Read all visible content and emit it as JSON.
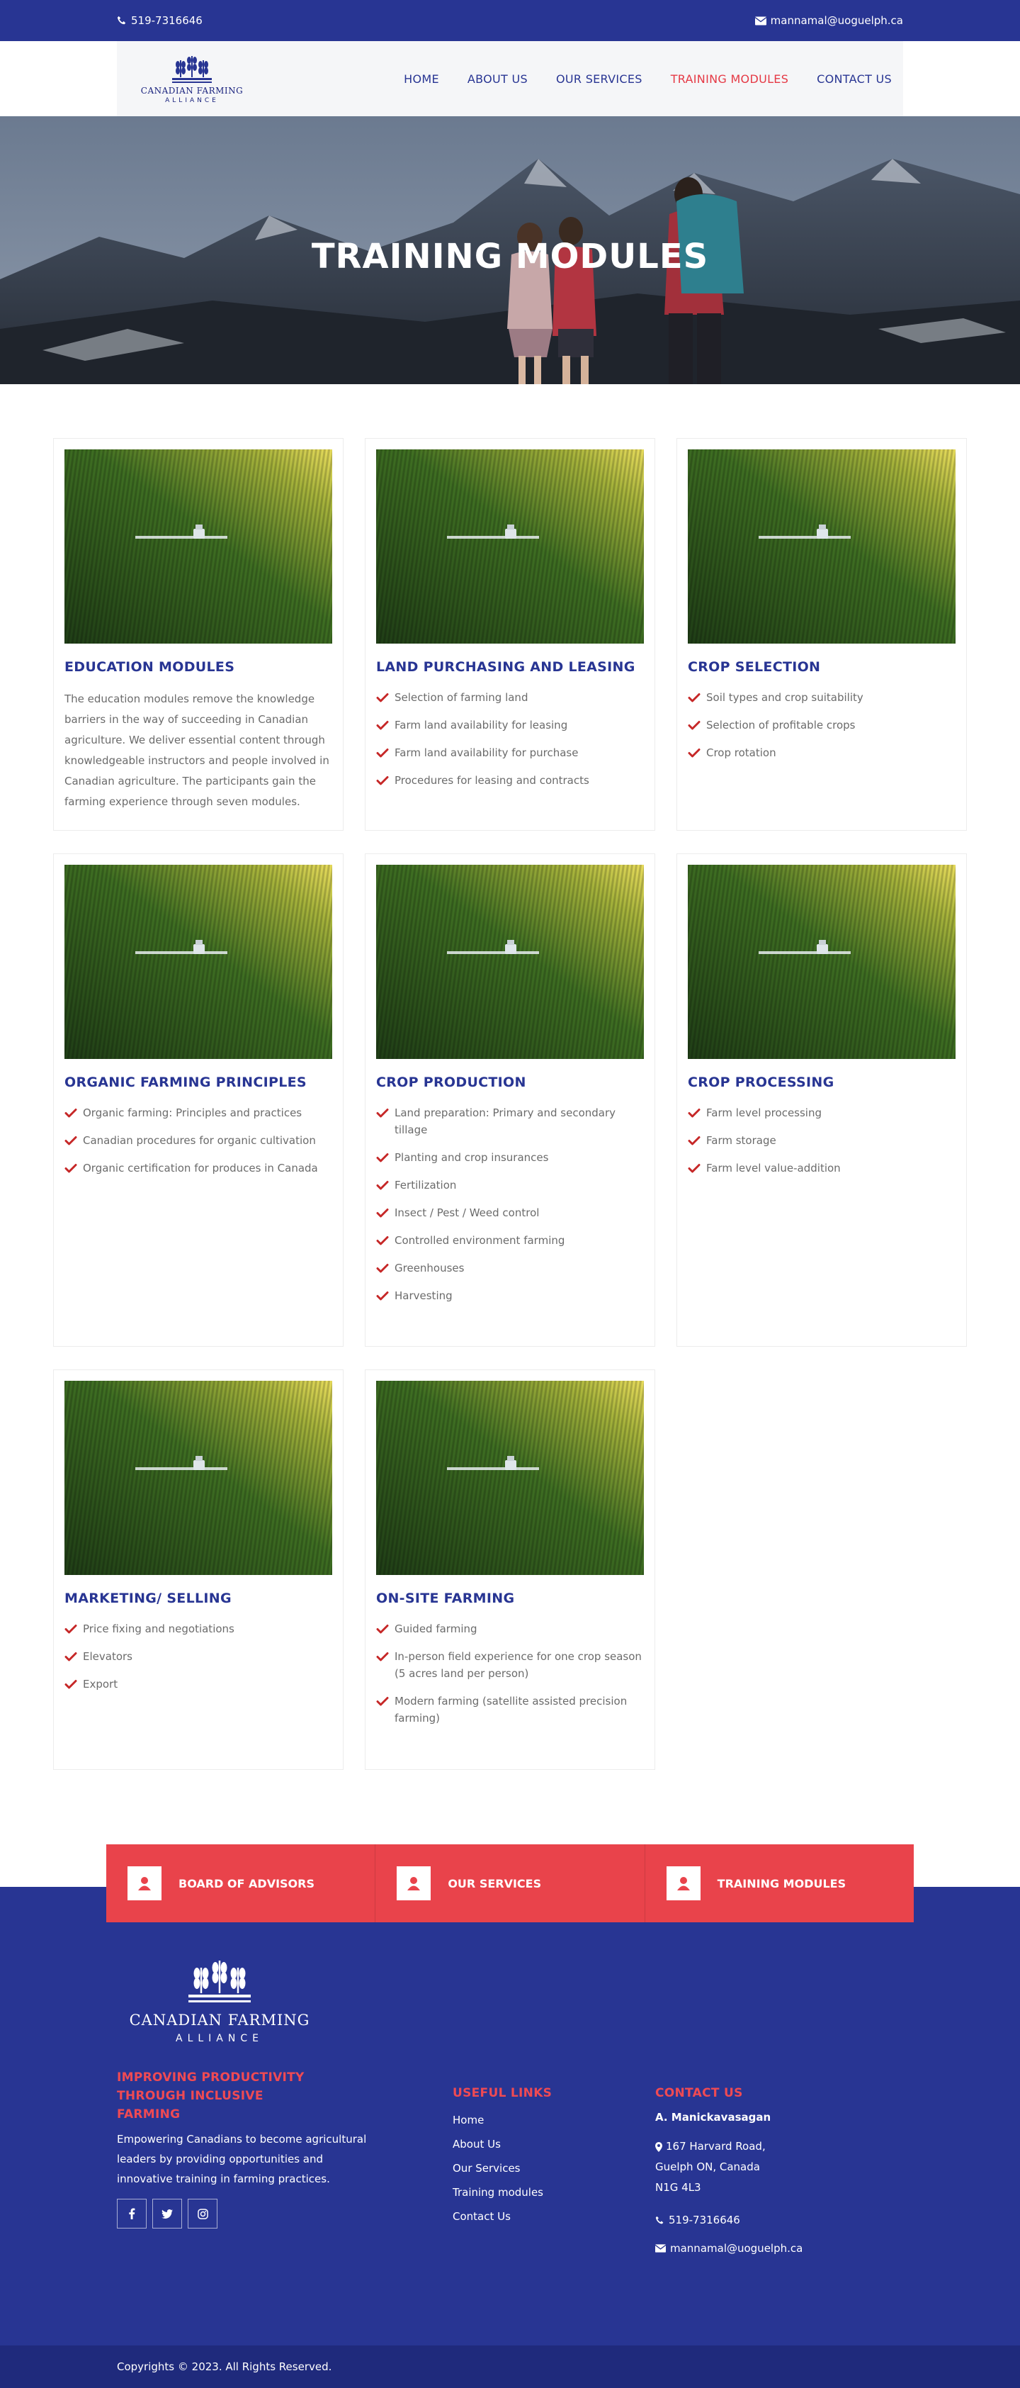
{
  "topbar": {
    "phone": "519-7316646",
    "email": "mannamal@uoguelph.ca"
  },
  "logo": {
    "name": "CANADIAN FARMING",
    "sub": "ALLIANCE"
  },
  "nav": [
    {
      "label": "HOME",
      "active": false
    },
    {
      "label": "ABOUT US",
      "active": false
    },
    {
      "label": "OUR SERVICES",
      "active": false
    },
    {
      "label": "TRAINING MODULES",
      "active": true
    },
    {
      "label": "CONTACT US",
      "active": false
    }
  ],
  "hero": {
    "title": "TRAINING MODULES"
  },
  "cards": [
    {
      "title": "EDUCATION MODULES",
      "text": "The education modules remove the knowledge barriers in the way of succeeding in Canadian agriculture. We deliver essential content through knowledgeable instructors and people involved in Canadian agriculture. The participants gain the farming experience through seven modules.",
      "items": []
    },
    {
      "title": "LAND PURCHASING AND LEASING",
      "text": "",
      "items": [
        "Selection of farming land",
        "Farm land availability for leasing",
        "Farm land availability for purchase",
        "Procedures for leasing and contracts"
      ]
    },
    {
      "title": "CROP SELECTION",
      "text": "",
      "items": [
        "Soil types and crop suitability",
        "Selection of profitable crops",
        "Crop rotation"
      ]
    },
    {
      "title": "ORGANIC FARMING PRINCIPLES",
      "text": "",
      "items": [
        "Organic farming: Principles and practices",
        "Canadian procedures for organic cultivation",
        "Organic certification for produces in Canada"
      ]
    },
    {
      "title": "CROP PRODUCTION",
      "text": "",
      "items": [
        "Land preparation: Primary and secondary tillage",
        "Planting and crop insurances",
        "Fertilization",
        "Insect / Pest / Weed control",
        "Controlled environment farming",
        "Greenhouses",
        "Harvesting"
      ]
    },
    {
      "title": "CROP PROCESSING",
      "text": "",
      "items": [
        "Farm level processing",
        "Farm storage",
        "Farm level value-addition"
      ]
    },
    {
      "title": "MARKETING/ SELLING",
      "text": "",
      "items": [
        "Price fixing and negotiations",
        "Elevators",
        "Export"
      ]
    },
    {
      "title": "ON-SITE FARMING",
      "text": "",
      "items": [
        "Guided farming",
        "In-person field experience for one crop season (5 acres land per person)",
        "Modern farming (satellite assisted precision farming)"
      ]
    }
  ],
  "cta": [
    {
      "label": "BOARD OF ADVISORS",
      "icon": "user-icon"
    },
    {
      "label": "OUR SERVICES",
      "icon": "user-icon"
    },
    {
      "label": "TRAINING MODULES",
      "icon": "user-icon"
    }
  ],
  "footer": {
    "logo_name": "CANADIAN FARMING",
    "logo_sub": "ALLIANCE",
    "tagline": "IMPROVING PRODUCTIVITY THROUGH INCLUSIVE FARMING",
    "about": "Empowering Canadians to become agricultural leaders by providing opportunities and innovative training in farming practices.",
    "social": [
      "f",
      "t",
      "ig"
    ],
    "links_title": "USEFUL LINKS",
    "links": [
      "Home",
      "About Us",
      "Our Services",
      "Training modules",
      "Contact Us"
    ],
    "contact_title": "CONTACT US",
    "contact_name": "A. Manickavasagan",
    "address1": "167 Harvard Road,",
    "address2": "Guelph ON, Canada",
    "address3": "N1G 4L3",
    "phone": "519-7316646",
    "email": "mannamal@uoguelph.ca"
  },
  "copyright": "Copyrights © 2023. All Rights Reserved.",
  "colors": {
    "primary": "#283593",
    "accent": "#e53945",
    "cta": "#e9434b"
  }
}
